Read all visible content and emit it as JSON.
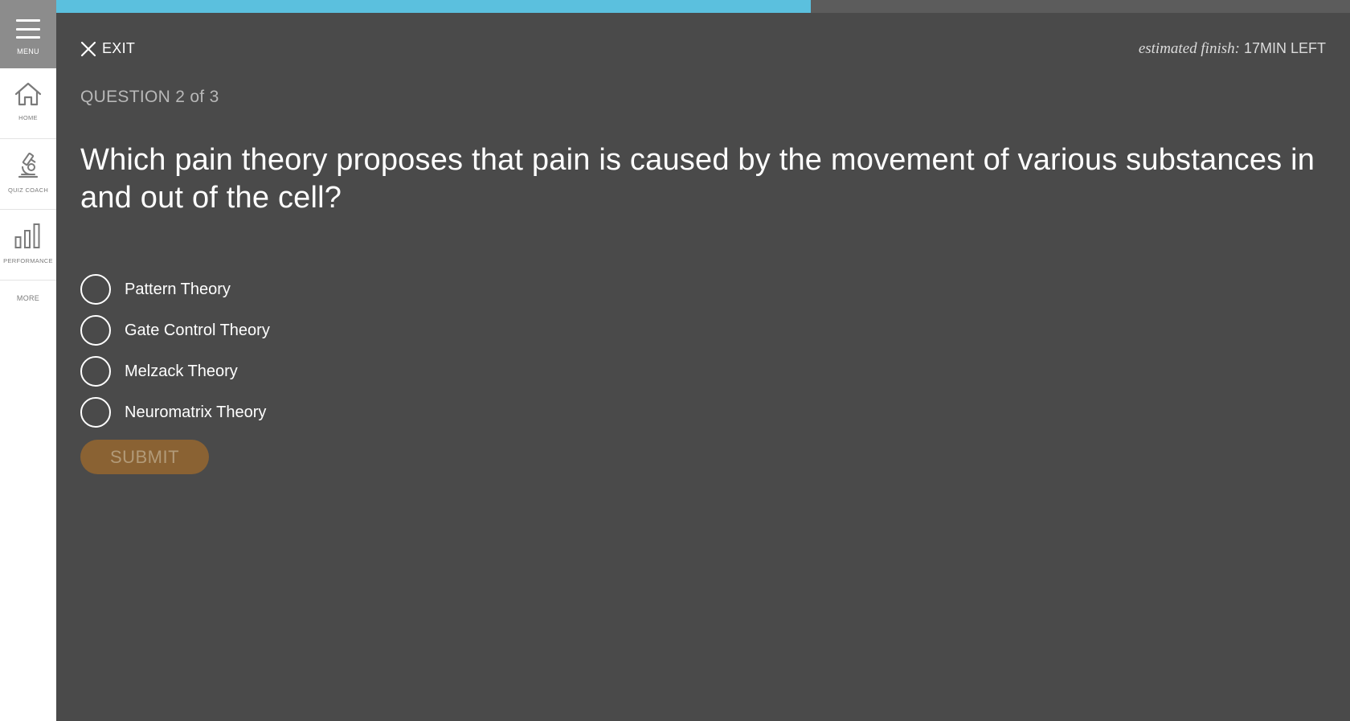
{
  "sidebar": {
    "menu_label": "MENU",
    "items": [
      {
        "label": "HOME",
        "icon": "home-icon"
      },
      {
        "label": "QUIZ COACH",
        "icon": "microscope-icon"
      },
      {
        "label": "PERFORMANCE",
        "icon": "bar-chart-icon"
      }
    ],
    "more_label": "MORE"
  },
  "progress": {
    "fraction": 0.583,
    "fill_color": "#5bc0de",
    "track_color": "#5c5c5c"
  },
  "header": {
    "exit_label": "EXIT",
    "estimate_label": "estimated finish:",
    "estimate_value": "17MIN LEFT"
  },
  "question": {
    "counter": "QUESTION 2 of 3",
    "text": "Which pain theory proposes that pain is caused by the movement of various substances in and out of the cell?",
    "options": [
      {
        "label": "Pattern Theory"
      },
      {
        "label": "Gate Control Theory"
      },
      {
        "label": "Melzack Theory"
      },
      {
        "label": "Neuromatrix Theory"
      }
    ]
  },
  "submit_label": "SUBMIT",
  "colors": {
    "background": "#4a4a4a",
    "sidebar": "#ffffff",
    "menu_button": "#8c8c8c",
    "submit_button": "#8a6233"
  }
}
